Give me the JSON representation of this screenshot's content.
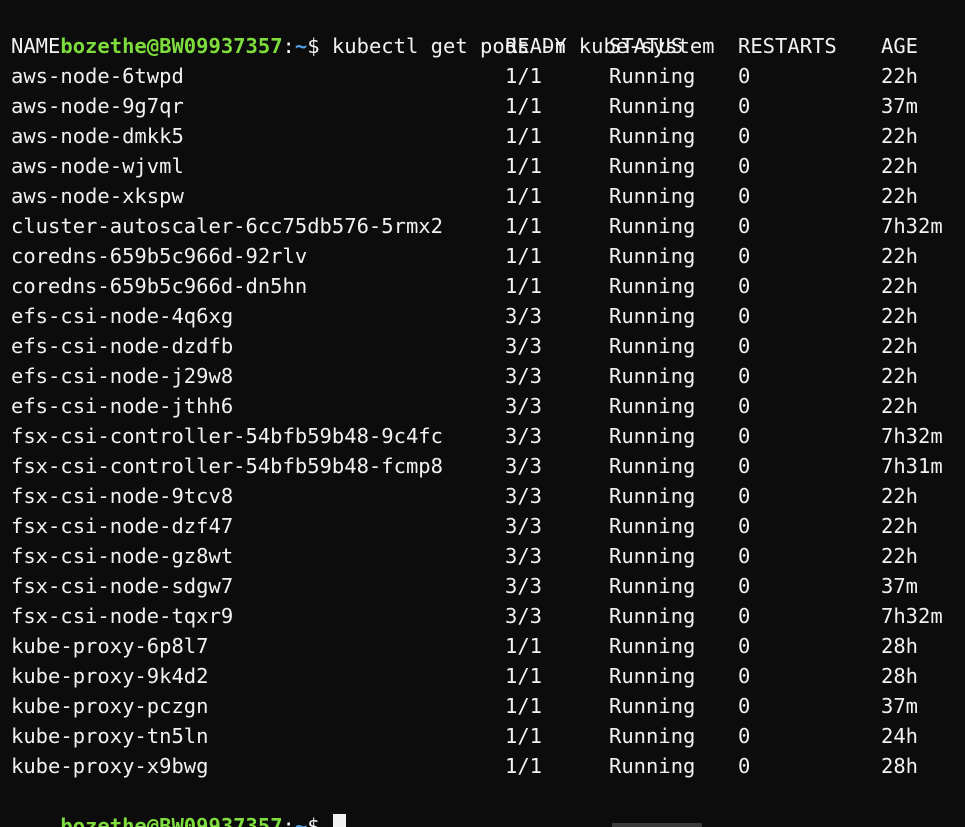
{
  "prompt": {
    "user_host": "bozethe@BW09937357",
    "colon": ":",
    "path": "~",
    "dollar": "$ ",
    "command": "kubectl get pods -n kube-system"
  },
  "table": {
    "headers": {
      "name": "NAME",
      "ready": "READY",
      "status": "STATUS",
      "restarts": "RESTARTS",
      "age": "AGE"
    },
    "rows": [
      {
        "name": "aws-node-6twpd",
        "ready": "1/1",
        "status": "Running",
        "restarts": "0",
        "age": "22h"
      },
      {
        "name": "aws-node-9g7qr",
        "ready": "1/1",
        "status": "Running",
        "restarts": "0",
        "age": "37m"
      },
      {
        "name": "aws-node-dmkk5",
        "ready": "1/1",
        "status": "Running",
        "restarts": "0",
        "age": "22h"
      },
      {
        "name": "aws-node-wjvml",
        "ready": "1/1",
        "status": "Running",
        "restarts": "0",
        "age": "22h"
      },
      {
        "name": "aws-node-xkspw",
        "ready": "1/1",
        "status": "Running",
        "restarts": "0",
        "age": "22h"
      },
      {
        "name": "cluster-autoscaler-6cc75db576-5rmx2",
        "ready": "1/1",
        "status": "Running",
        "restarts": "0",
        "age": "7h32m"
      },
      {
        "name": "coredns-659b5c966d-92rlv",
        "ready": "1/1",
        "status": "Running",
        "restarts": "0",
        "age": "22h"
      },
      {
        "name": "coredns-659b5c966d-dn5hn",
        "ready": "1/1",
        "status": "Running",
        "restarts": "0",
        "age": "22h"
      },
      {
        "name": "efs-csi-node-4q6xg",
        "ready": "3/3",
        "status": "Running",
        "restarts": "0",
        "age": "22h"
      },
      {
        "name": "efs-csi-node-dzdfb",
        "ready": "3/3",
        "status": "Running",
        "restarts": "0",
        "age": "22h"
      },
      {
        "name": "efs-csi-node-j29w8",
        "ready": "3/3",
        "status": "Running",
        "restarts": "0",
        "age": "22h"
      },
      {
        "name": "efs-csi-node-jthh6",
        "ready": "3/3",
        "status": "Running",
        "restarts": "0",
        "age": "22h"
      },
      {
        "name": "fsx-csi-controller-54bfb59b48-9c4fc",
        "ready": "3/3",
        "status": "Running",
        "restarts": "0",
        "age": "7h32m"
      },
      {
        "name": "fsx-csi-controller-54bfb59b48-fcmp8",
        "ready": "3/3",
        "status": "Running",
        "restarts": "0",
        "age": "7h31m"
      },
      {
        "name": "fsx-csi-node-9tcv8",
        "ready": "3/3",
        "status": "Running",
        "restarts": "0",
        "age": "22h"
      },
      {
        "name": "fsx-csi-node-dzf47",
        "ready": "3/3",
        "status": "Running",
        "restarts": "0",
        "age": "22h"
      },
      {
        "name": "fsx-csi-node-gz8wt",
        "ready": "3/3",
        "status": "Running",
        "restarts": "0",
        "age": "22h"
      },
      {
        "name": "fsx-csi-node-sdgw7",
        "ready": "3/3",
        "status": "Running",
        "restarts": "0",
        "age": "37m"
      },
      {
        "name": "fsx-csi-node-tqxr9",
        "ready": "3/3",
        "status": "Running",
        "restarts": "0",
        "age": "7h32m"
      },
      {
        "name": "kube-proxy-6p8l7",
        "ready": "1/1",
        "status": "Running",
        "restarts": "0",
        "age": "28h"
      },
      {
        "name": "kube-proxy-9k4d2",
        "ready": "1/1",
        "status": "Running",
        "restarts": "0",
        "age": "28h"
      },
      {
        "name": "kube-proxy-pczgn",
        "ready": "1/1",
        "status": "Running",
        "restarts": "0",
        "age": "37m"
      },
      {
        "name": "kube-proxy-tn5ln",
        "ready": "1/1",
        "status": "Running",
        "restarts": "0",
        "age": "24h"
      },
      {
        "name": "kube-proxy-x9bwg",
        "ready": "1/1",
        "status": "Running",
        "restarts": "0",
        "age": "28h"
      }
    ]
  },
  "colors": {
    "background": "#0c0c0c",
    "foreground": "#f2f2f2",
    "prompt_user": "#7edc3c",
    "prompt_path": "#4fa0e8"
  }
}
